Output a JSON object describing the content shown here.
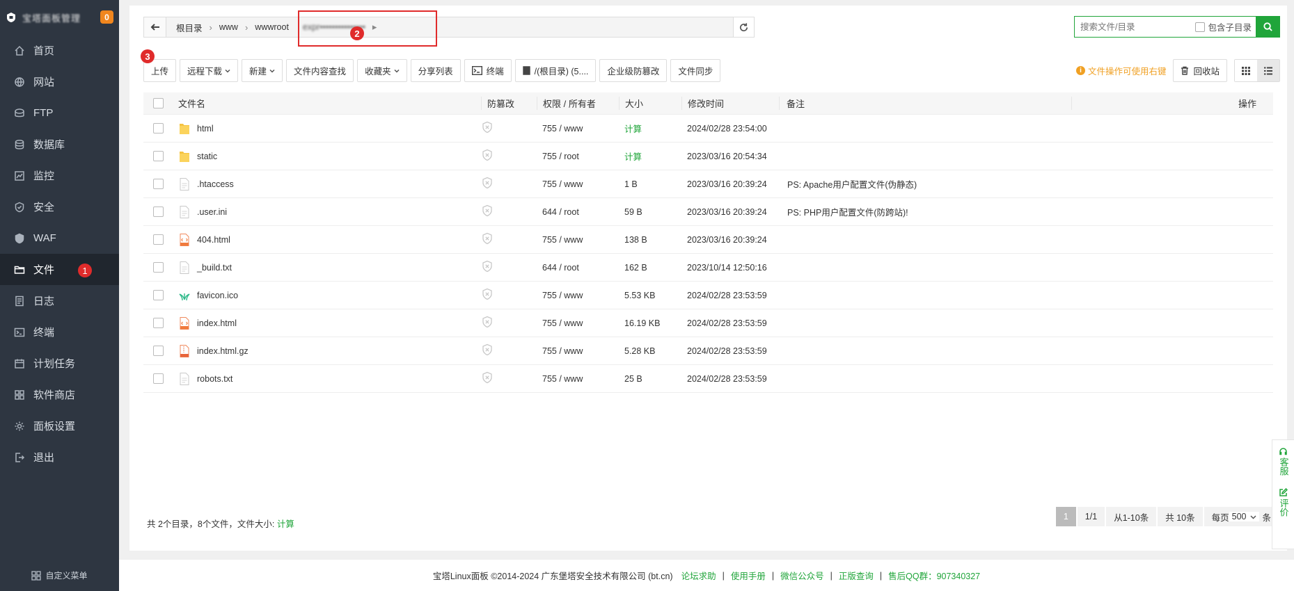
{
  "sidebar": {
    "brand": "宝塔面板管理",
    "badge": "0",
    "items": [
      {
        "label": "首页",
        "icon": "home-icon"
      },
      {
        "label": "网站",
        "icon": "globe-icon"
      },
      {
        "label": "FTP",
        "icon": "ftp-icon"
      },
      {
        "label": "数据库",
        "icon": "database-icon"
      },
      {
        "label": "监控",
        "icon": "monitor-icon"
      },
      {
        "label": "安全",
        "icon": "shield-icon"
      },
      {
        "label": "WAF",
        "icon": "waf-icon"
      },
      {
        "label": "文件",
        "icon": "folder-icon",
        "active": true
      },
      {
        "label": "日志",
        "icon": "log-icon"
      },
      {
        "label": "终端",
        "icon": "terminal-icon"
      },
      {
        "label": "计划任务",
        "icon": "calendar-icon"
      },
      {
        "label": "软件商店",
        "icon": "apps-icon"
      },
      {
        "label": "面板设置",
        "icon": "gear-icon"
      },
      {
        "label": "退出",
        "icon": "logout-icon"
      }
    ],
    "custom_menu": "自定义菜单"
  },
  "markers": {
    "one": "1",
    "two": "2",
    "three": "3"
  },
  "pathbar": {
    "crumbs": [
      "根目录",
      "www",
      "wwwroot"
    ],
    "current_blurred": "expr•••••••••••••••"
  },
  "search": {
    "placeholder": "搜索文件/目录",
    "include_sub": "包含子目录"
  },
  "toolbar": {
    "upload": "上传",
    "remote_download": "远程下载",
    "new": "新建",
    "content_search": "文件内容查找",
    "favorites": "收藏夹",
    "share_list": "分享列表",
    "terminal": "终端",
    "disk": "/(根目录) (5....",
    "tamper": "企业级防篡改",
    "sync": "文件同步",
    "tip": "文件操作可使用右键",
    "recycle": "回收站"
  },
  "table": {
    "headers": {
      "name": "文件名",
      "protect": "防篡改",
      "perm": "权限 / 所有者",
      "size": "大小",
      "mtime": "修改时间",
      "note": "备注",
      "ops": "操作"
    },
    "rows": [
      {
        "name": "html",
        "type": "folder",
        "perm": "755 / www",
        "size": "计算",
        "mtime": "2024/02/28 23:54:00",
        "note": ""
      },
      {
        "name": "static",
        "type": "folder",
        "perm": "755 / root",
        "size": "计算",
        "mtime": "2023/03/16 20:54:34",
        "note": ""
      },
      {
        "name": ".htaccess",
        "type": "file",
        "perm": "755 / www",
        "size": "1 B",
        "mtime": "2023/03/16 20:39:24",
        "note": "PS: Apache用户配置文件(伪静态)"
      },
      {
        "name": ".user.ini",
        "type": "file",
        "perm": "644 / root",
        "size": "59 B",
        "mtime": "2023/03/16 20:39:24",
        "note": "PS: PHP用户配置文件(防跨站)!"
      },
      {
        "name": "404.html",
        "type": "html",
        "perm": "755 / www",
        "size": "138 B",
        "mtime": "2023/03/16 20:39:24",
        "note": ""
      },
      {
        "name": "_build.txt",
        "type": "file",
        "perm": "644 / root",
        "size": "162 B",
        "mtime": "2023/10/14 12:50:16",
        "note": ""
      },
      {
        "name": "favicon.ico",
        "type": "ico",
        "perm": "755 / www",
        "size": "5.53 KB",
        "mtime": "2024/02/28 23:53:59",
        "note": ""
      },
      {
        "name": "index.html",
        "type": "html",
        "perm": "755 / www",
        "size": "16.19 KB",
        "mtime": "2024/02/28 23:53:59",
        "note": ""
      },
      {
        "name": "index.html.gz",
        "type": "gz",
        "perm": "755 / www",
        "size": "5.28 KB",
        "mtime": "2024/02/28 23:53:59",
        "note": ""
      },
      {
        "name": "robots.txt",
        "type": "file",
        "perm": "755 / www",
        "size": "25 B",
        "mtime": "2024/02/28 23:53:59",
        "note": ""
      }
    ]
  },
  "summary": {
    "text": "共 2个目录，8个文件，文件大小: ",
    "calc": "计算"
  },
  "pager": {
    "current": "1",
    "pages": "1/1",
    "range": "从1-10条",
    "total": "共 10条",
    "per_page_label": "每页",
    "per_page": "500",
    "unit": "条"
  },
  "float": {
    "service": "客服",
    "review": "评价"
  },
  "footer": {
    "copyright": "宝塔Linux面板 ©2014-2024 广东堡塔安全技术有限公司 (bt.cn)",
    "links": [
      "论坛求助",
      "使用手册",
      "微信公众号",
      "正版查询",
      "售后QQ群：907340327"
    ]
  },
  "colors": {
    "accent": "#20a53a",
    "sidebar": "#2e3641",
    "marker": "#e02b2b",
    "warning": "#f0a023",
    "badge": "#f0861e"
  }
}
